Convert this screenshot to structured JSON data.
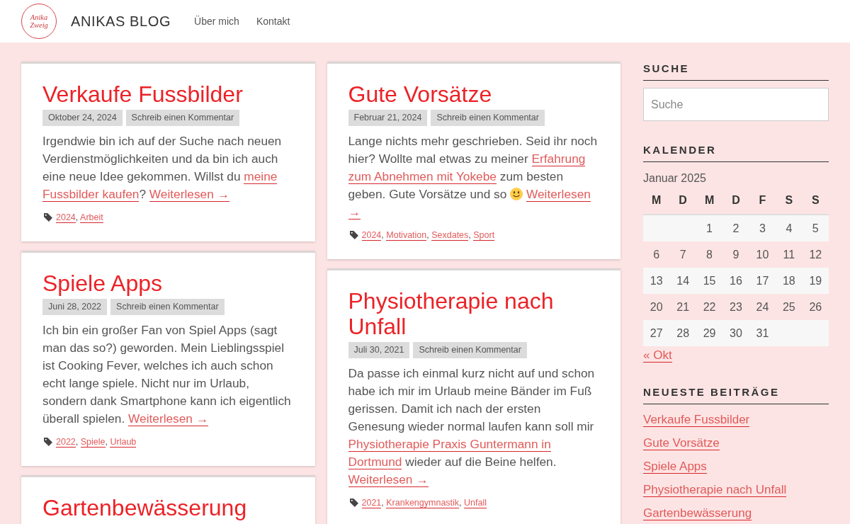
{
  "header": {
    "logo_lines": [
      "Anika",
      "Zweig"
    ],
    "site_title": "ANIKAS BLOG",
    "nav": [
      {
        "label": "Über mich"
      },
      {
        "label": "Kontakt"
      }
    ]
  },
  "posts": [
    {
      "title": "Verkaufe Fussbilder",
      "date": "Oktober 24, 2024",
      "comment_link": "Schreib einen Kommentar",
      "excerpt": [
        {
          "kind": "text",
          "text": "Irgendwie bin ich auf der Suche nach neuen Verdienstmöglichkeiten und da bin ich auch eine neue Idee gekommen. Willst du "
        },
        {
          "kind": "link",
          "text": "meine"
        },
        {
          "kind": "link",
          "text": "Fussbilder kaufen"
        },
        {
          "kind": "text",
          "text": "? "
        },
        {
          "kind": "more",
          "text": "Weiterlesen →"
        }
      ],
      "tags": [
        {
          "label": "2024",
          "after": ", "
        },
        {
          "label": "Arbeit"
        }
      ]
    },
    {
      "title": "Gute Vorsätze",
      "date": "Februar 21, 2024",
      "comment_link": "Schreib einen Kommentar",
      "excerpt": [
        {
          "kind": "text",
          "text": "Lange nichts mehr geschrieben. Seid ihr noch hier? Wollte mal etwas zu meiner "
        },
        {
          "kind": "link",
          "text": "Erfahrung"
        },
        {
          "kind": "link",
          "text": "zum Abnehmen mit Yokebe"
        },
        {
          "kind": "text",
          "text": " zum besten geben. Gute Vorsätze und so "
        },
        {
          "kind": "emoji"
        },
        {
          "kind": "more",
          "text": "Weiterlesen"
        },
        {
          "kind": "more",
          "text": "→"
        }
      ],
      "tags": [
        {
          "label": "2024",
          "after": ", "
        },
        {
          "label": "Motivation",
          "after": ", "
        },
        {
          "label": "Sexdates",
          "after": ", "
        },
        {
          "label": "Sport"
        }
      ]
    },
    {
      "title": "Spiele Apps",
      "date": "Juni 28, 2022",
      "comment_link": "Schreib einen Kommentar",
      "excerpt": [
        {
          "kind": "text",
          "text": "Ich bin ein großer Fan von Spiel Apps (sagt man das so?) geworden. Mein Lieblingsspiel ist Cooking Fever, welches ich auch schon echt lange spiele. Nicht nur im Urlaub, sondern dank Smartphone kann ich eigentlich überall spielen. "
        },
        {
          "kind": "more",
          "text": "Weiterlesen →"
        }
      ],
      "tags": [
        {
          "label": "2022",
          "after": ", "
        },
        {
          "label": "Spiele",
          "after": ", "
        },
        {
          "label": "Urlaub"
        }
      ]
    },
    {
      "title": "Physiotherapie nach Unfall",
      "date": "Juli 30, 2021",
      "comment_link": "Schreib einen Kommentar",
      "excerpt": [
        {
          "kind": "text",
          "text": "Da passe ich einmal kurz nicht auf und schon habe ich mir im Urlaub meine Bänder im Fuß gerissen. Damit ich nach der ersten Genesung wieder normal laufen kann soll mir "
        },
        {
          "kind": "link",
          "text": "Physiotherapie Praxis Guntermann in"
        },
        {
          "kind": "link",
          "text": "Dortmund"
        },
        {
          "kind": "text",
          "text": " wieder auf die Beine helfen. "
        },
        {
          "kind": "more",
          "text": "Weiterlesen →"
        }
      ],
      "tags": [
        {
          "label": "2021",
          "after": ", "
        },
        {
          "label": "Krankengymnastik",
          "after": ", "
        },
        {
          "label": "Unfall"
        }
      ]
    },
    {
      "title": "Gartenbewässerung"
    }
  ],
  "sidebar": {
    "search": {
      "title": "SUCHE",
      "placeholder": "Suche"
    },
    "calendar": {
      "title": "KALENDER",
      "caption": "Januar 2025",
      "weekdays": [
        "M",
        "D",
        "M",
        "D",
        "F",
        "S",
        "S"
      ],
      "weeks": [
        {
          "days": [
            "1",
            "2",
            "3",
            "4",
            "5"
          ],
          "align_end": true
        },
        {
          "days": [
            "6",
            "7",
            "8",
            "9",
            "10",
            "11",
            "12"
          ]
        },
        {
          "days": [
            "13",
            "14",
            "15",
            "16",
            "17",
            "18",
            "19"
          ]
        },
        {
          "days": [
            "20",
            "21",
            "22",
            "23",
            "24",
            "25",
            "26"
          ]
        },
        {
          "days": [
            "27",
            "28",
            "29",
            "30",
            "31"
          ]
        }
      ],
      "prev_link": "« Okt"
    },
    "recent_posts": {
      "title": "NEUESTE BEITRÄGE",
      "items": [
        "Verkaufe Fussbilder",
        "Gute Vorsätze",
        "Spiele Apps",
        "Physiotherapie nach Unfall",
        "Gartenbewässerung"
      ]
    }
  }
}
